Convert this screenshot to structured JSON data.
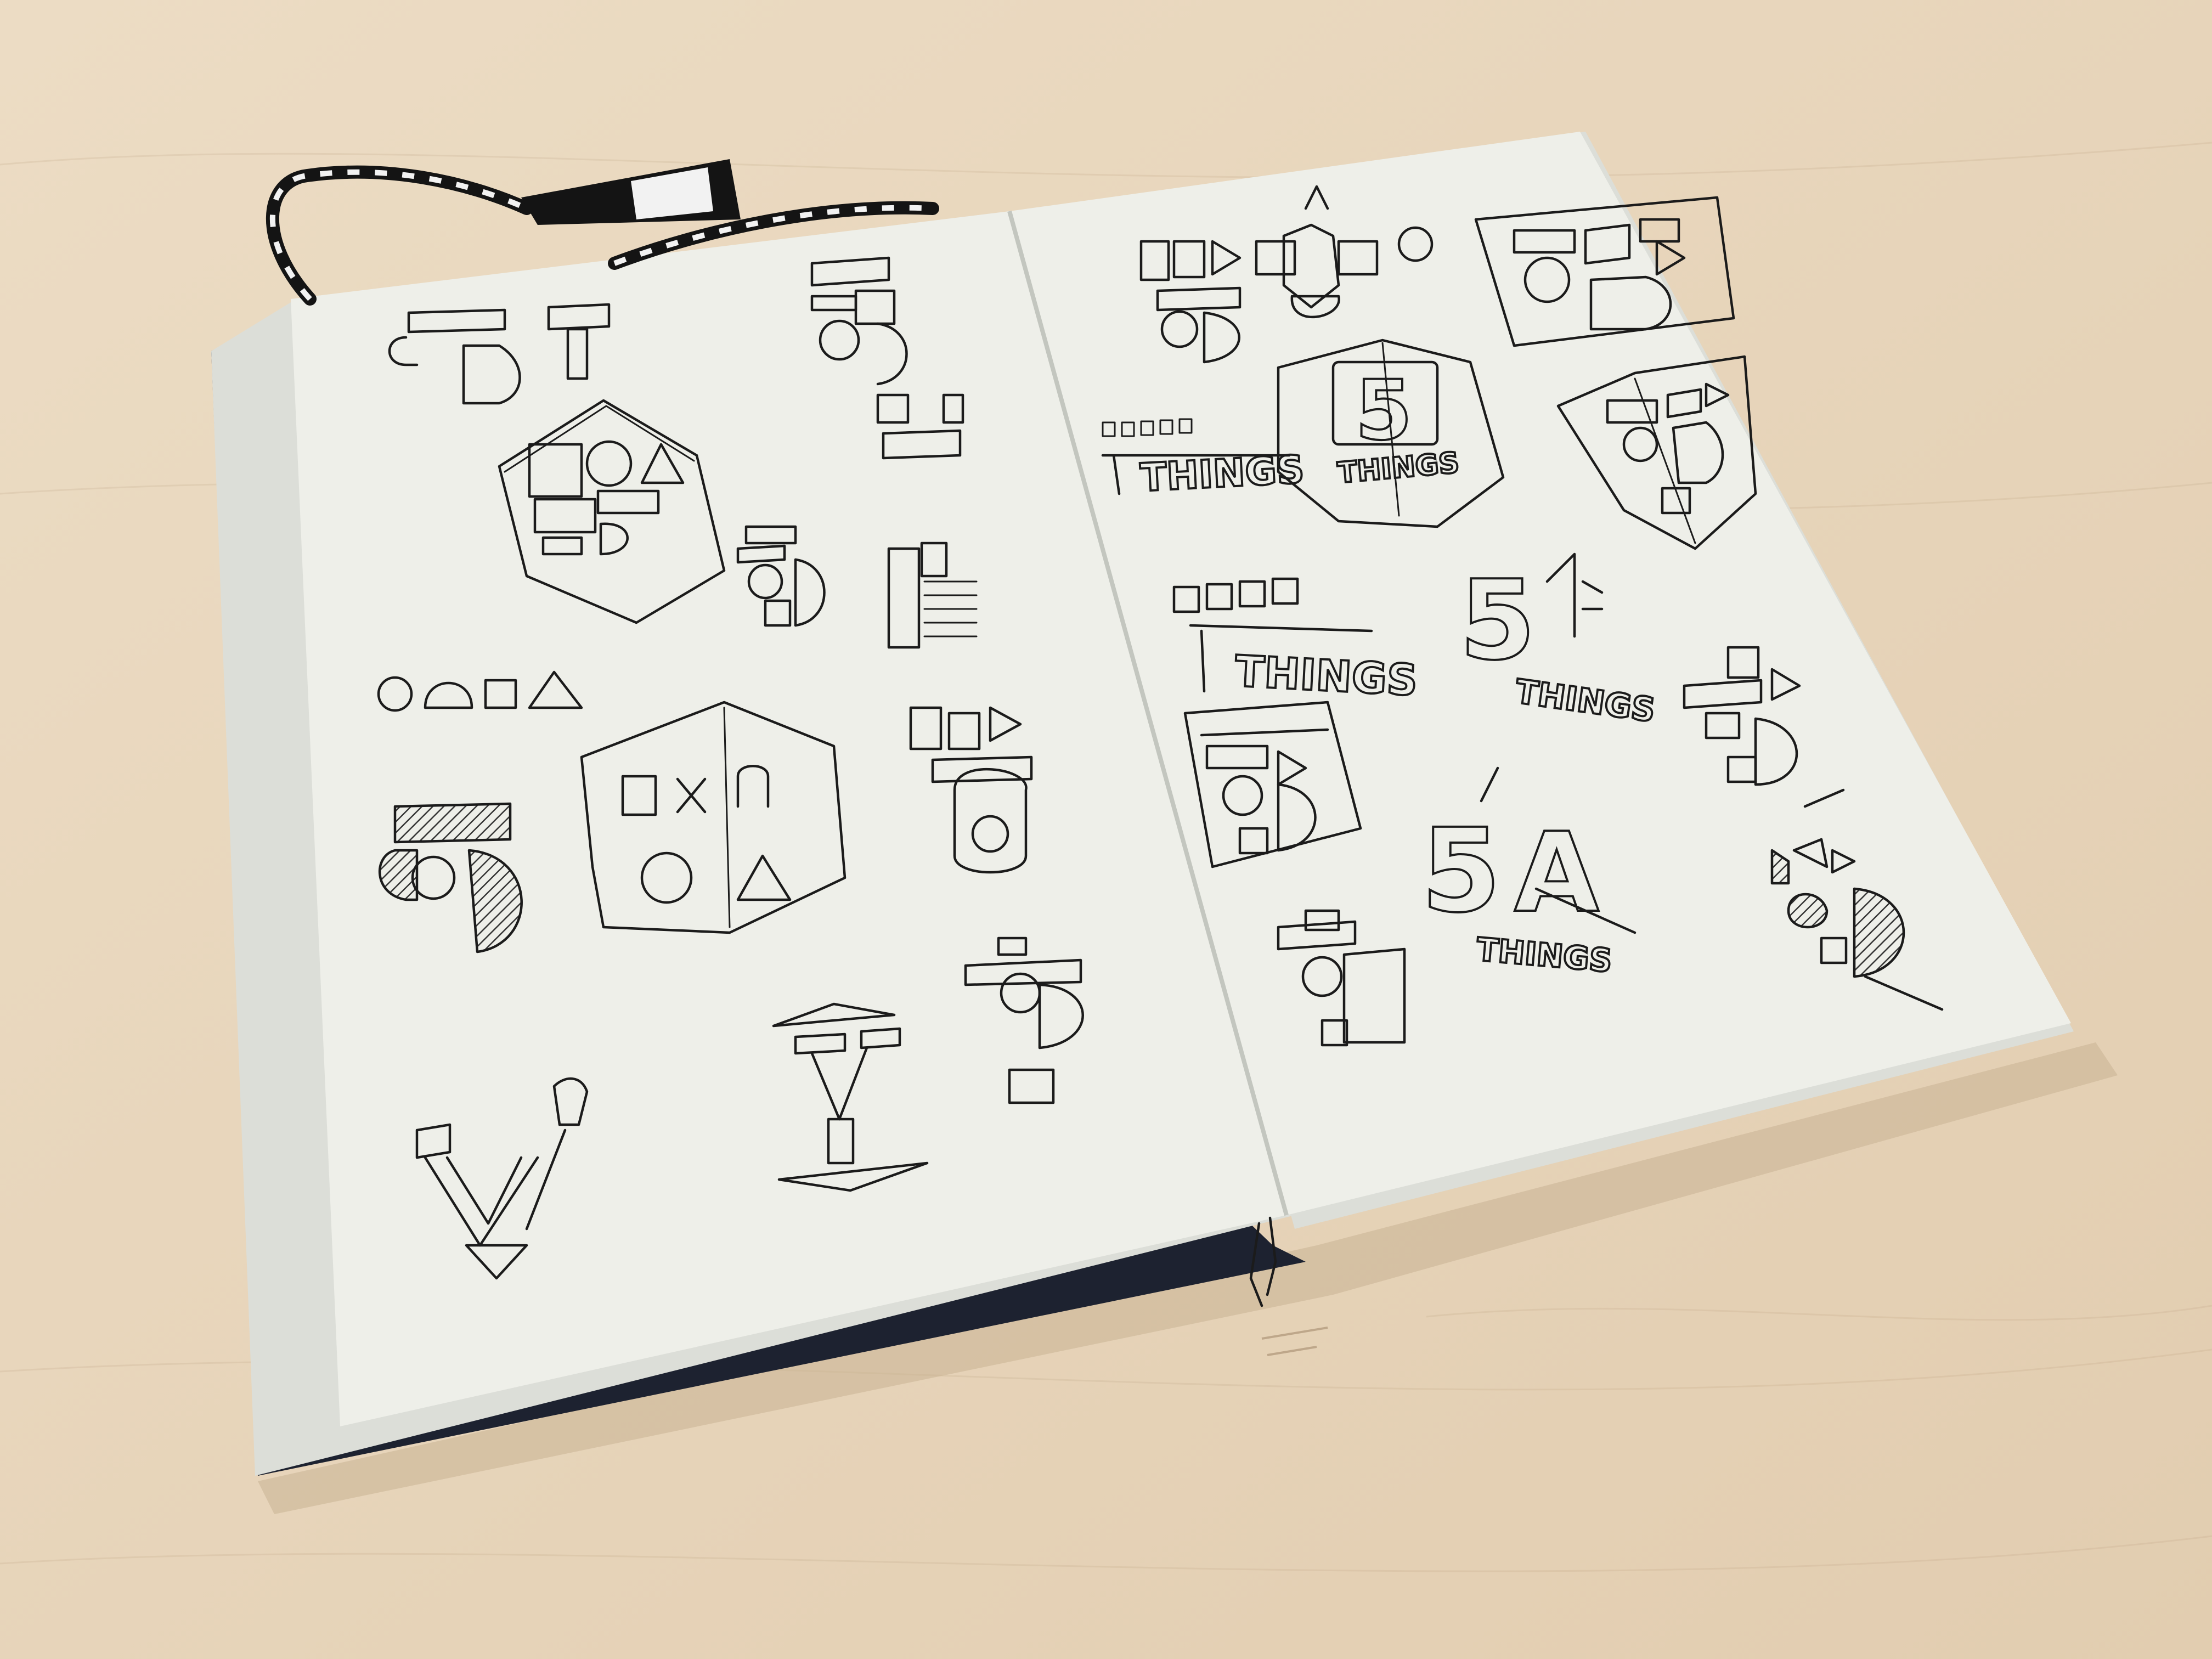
{
  "scene": {
    "subject": "Open sketchbook with hand-drawn logo concepts on a wooden table",
    "colors": {
      "table": "#e9d7bf",
      "table_shadow": "#d8c3a6",
      "paper": "#eeefe9",
      "page_edge": "#d9dbd5",
      "cover": "#1d2230",
      "ink": "#1b1b1b",
      "ribbon_dark": "#141414",
      "ribbon_light": "#f2f2f2"
    }
  },
  "sketch_text": {
    "right_five_1": "5",
    "right_things_1": "THINGS",
    "right_things_2": "THINGS",
    "right_things_3": "THINGS",
    "right_things_4": "THINGS",
    "right_things_5": "THINGS",
    "right_five_2": "5",
    "right_five_3": "5",
    "right_a_1": "A",
    "left_v_1": "V",
    "left_y_1": "Y"
  }
}
